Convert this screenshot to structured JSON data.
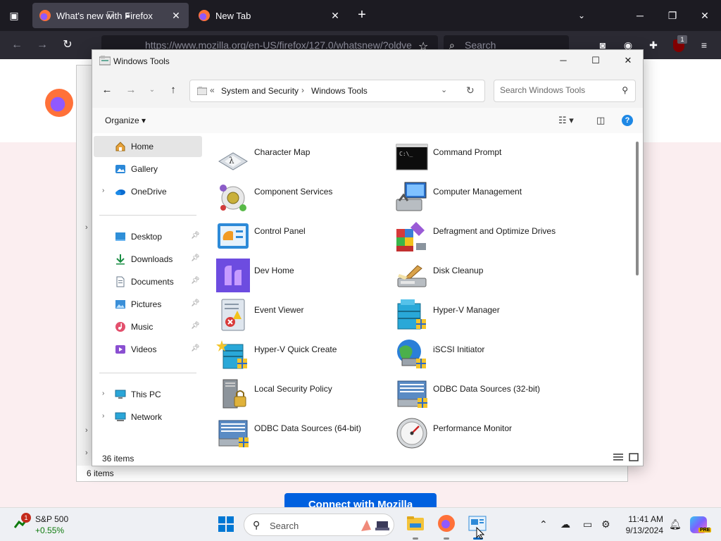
{
  "browser": {
    "tabs": [
      {
        "title": "What's new with Firefox",
        "active": true
      },
      {
        "title": "New Tab",
        "active": false
      }
    ],
    "url": "https://www.mozilla.org/en-US/firefox/127.0/whatsnew/?oldve",
    "search_placeholder": "Search",
    "extension_badge": "1"
  },
  "page": {
    "button_label": "Connect with Mozilla",
    "back_window_status": "6 items"
  },
  "window": {
    "title": "Windows Tools",
    "breadcrumb": [
      "System and Security",
      "Windows Tools"
    ],
    "search_placeholder": "Search Windows Tools",
    "organize_label": "Organize",
    "status_count": "36 items"
  },
  "nav_pane": {
    "items": [
      {
        "label": "Home",
        "icon": "home-icon",
        "selected": true
      },
      {
        "label": "Gallery",
        "icon": "gallery-icon"
      },
      {
        "label": "OneDrive",
        "icon": "onedrive-icon",
        "expandable": true
      },
      {
        "label": "Desktop",
        "icon": "desktop-icon",
        "pinned": true
      },
      {
        "label": "Downloads",
        "icon": "downloads-icon",
        "pinned": true
      },
      {
        "label": "Documents",
        "icon": "documents-icon",
        "pinned": true
      },
      {
        "label": "Pictures",
        "icon": "pictures-icon",
        "pinned": true
      },
      {
        "label": "Music",
        "icon": "music-icon",
        "pinned": true
      },
      {
        "label": "Videos",
        "icon": "videos-icon",
        "pinned": true
      },
      {
        "label": "This PC",
        "icon": "this-pc-icon",
        "expandable": true
      },
      {
        "label": "Network",
        "icon": "network-icon",
        "expandable": true
      }
    ]
  },
  "tools": [
    {
      "name": "Character Map",
      "icon": "character-map-icon"
    },
    {
      "name": "Command Prompt",
      "icon": "command-prompt-icon"
    },
    {
      "name": "Component Services",
      "icon": "component-services-icon"
    },
    {
      "name": "Computer Management",
      "icon": "computer-management-icon"
    },
    {
      "name": "Control Panel",
      "icon": "control-panel-icon"
    },
    {
      "name": "Defragment and Optimize Drives",
      "icon": "defragment-icon"
    },
    {
      "name": "Dev Home",
      "icon": "dev-home-icon"
    },
    {
      "name": "Disk Cleanup",
      "icon": "disk-cleanup-icon"
    },
    {
      "name": "Event Viewer",
      "icon": "event-viewer-icon"
    },
    {
      "name": "Hyper-V Manager",
      "icon": "hyper-v-manager-icon"
    },
    {
      "name": "Hyper-V Quick Create",
      "icon": "hyper-v-quick-create-icon"
    },
    {
      "name": "iSCSI Initiator",
      "icon": "iscsi-initiator-icon"
    },
    {
      "name": "Local Security Policy",
      "icon": "local-security-policy-icon"
    },
    {
      "name": "ODBC Data Sources (32-bit)",
      "icon": "odbc-32-icon"
    },
    {
      "name": "ODBC Data Sources (64-bit)",
      "icon": "odbc-64-icon"
    },
    {
      "name": "Performance Monitor",
      "icon": "performance-monitor-icon"
    }
  ],
  "taskbar": {
    "stock_name": "S&P 500",
    "stock_change": "+0.55%",
    "stock_badge": "1",
    "search_label": "Search",
    "time": "11:41 AM",
    "date": "9/13/2024",
    "copilot_badge": "PRE"
  }
}
